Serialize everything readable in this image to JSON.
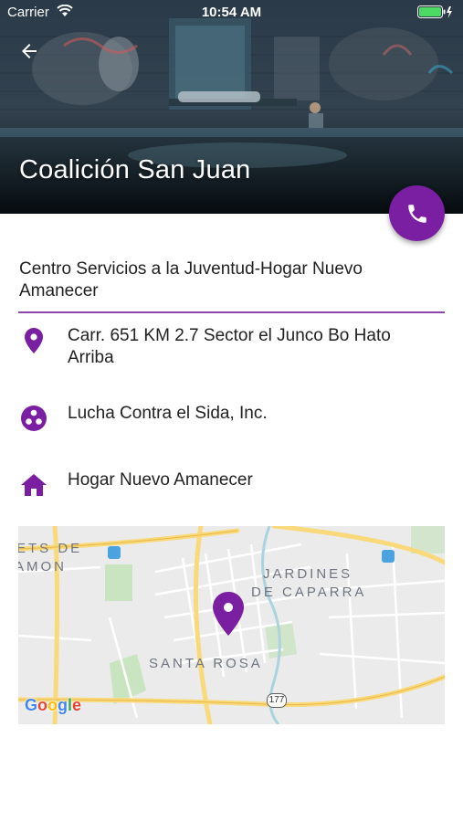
{
  "status_bar": {
    "carrier": "Carrier",
    "time": "10:54 AM"
  },
  "header": {
    "title": "Coalición San Juan",
    "back_icon": "arrow-back-icon",
    "call_icon": "phone-icon"
  },
  "details": {
    "organization": "Centro Servicios a la Juventud-Hogar Nuevo Amanecer",
    "address": "Carr. 651 KM 2.7 Sector el Junco Bo Hato Arriba",
    "affiliation": "Lucha Contra el Sida, Inc.",
    "program": "Hogar Nuevo Amanecer"
  },
  "map": {
    "labels": {
      "top_left_1": "ETS DE",
      "top_left_2": "AMON",
      "jardines": "JARDINES",
      "caparra": "DE CAPARRA",
      "santa_rosa": "SANTA ROSA",
      "route": "177",
      "google": "Google"
    }
  },
  "colors": {
    "accent": "#7b1fa2",
    "divider": "#8e44ad",
    "text": "#212121"
  }
}
